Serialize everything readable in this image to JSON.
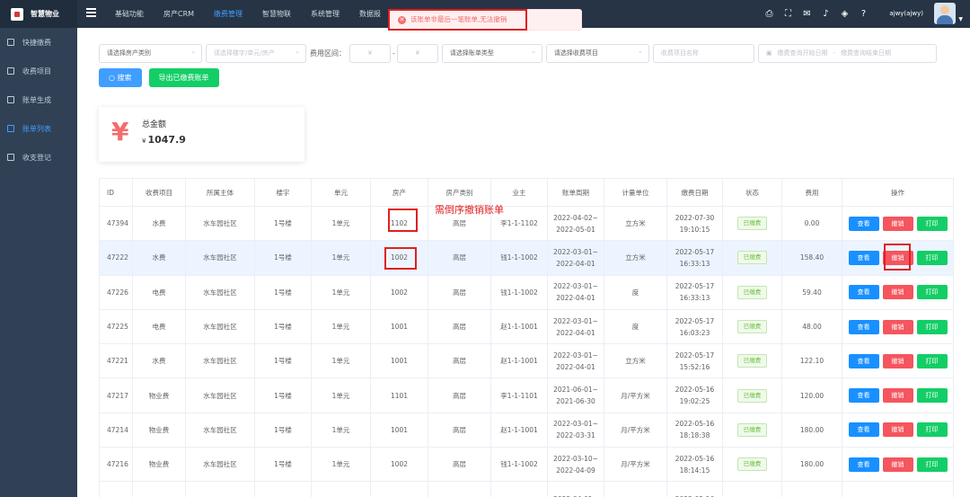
{
  "app": {
    "name": "智慧物业"
  },
  "nav": [
    "基础功能",
    "房产CRM",
    "缴费管理",
    "智慧物联",
    "系统管理",
    "数据报"
  ],
  "nav_active": 2,
  "user": {
    "name": "ajwy(ajwy)"
  },
  "sidebar": [
    "快捷缴费",
    "收费项目",
    "账单生成",
    "账单列表",
    "收支登记"
  ],
  "sidebar_active": 3,
  "filters": {
    "house_type": "请选择房产类别",
    "building_placeholder": "请选择楼宇/单元/房产",
    "fee_range_label": "费用区间：",
    "yen_min": "¥",
    "range_dash": "-",
    "yen_max": "¥",
    "bill_type": "请选择账单类型",
    "fee_item": "请选择收费项目",
    "item_name_placeholder": "收费项目名称",
    "start_date_placeholder": "缴费查询开始日期",
    "date_dash": "-",
    "end_date_placeholder": "缴费查询结束日期"
  },
  "buttons": {
    "search": "搜索",
    "export": "导出已缴费账单"
  },
  "summary": {
    "symbol": "¥",
    "label": "总金额",
    "currency": "¥",
    "amount": "1047.9"
  },
  "toast": {
    "text": "该账单非最后一笔账单,无法撤销"
  },
  "annotation": "需倒序撤销账单",
  "table": {
    "headers": [
      "ID",
      "收费项目",
      "所属主体",
      "楼宇",
      "单元",
      "房产",
      "房产类别",
      "业主",
      "账单周期",
      "计量单位",
      "缴费日期",
      "状态",
      "费用",
      "操作"
    ],
    "actions": {
      "view": "查看",
      "cancel": "撤销",
      "print": "打印"
    },
    "rows": [
      {
        "id": "47394",
        "item": "水费",
        "org": "水车园社区",
        "building": "1号楼",
        "unit": "1单元",
        "house": "1102",
        "type": "高层",
        "owner": "李1-1-1102",
        "p1": "2022-04-02~",
        "p2": "2022-05-01",
        "measure": "立方米",
        "d1": "2022-07-30",
        "d2": "19:10:15",
        "status": "已缴费",
        "fee": "0.00"
      },
      {
        "id": "47222",
        "item": "水费",
        "org": "水车园社区",
        "building": "1号楼",
        "unit": "1单元",
        "house": "1002",
        "type": "高层",
        "owner": "钱1-1-1002",
        "p1": "2022-03-01~",
        "p2": "2022-04-01",
        "measure": "立方米",
        "d1": "2022-05-17",
        "d2": "16:33:13",
        "status": "已缴费",
        "fee": "158.40"
      },
      {
        "id": "47226",
        "item": "电费",
        "org": "水车园社区",
        "building": "1号楼",
        "unit": "1单元",
        "house": "1002",
        "type": "高层",
        "owner": "钱1-1-1002",
        "p1": "2022-03-01~",
        "p2": "2022-04-01",
        "measure": "度",
        "d1": "2022-05-17",
        "d2": "16:33:13",
        "status": "已缴费",
        "fee": "59.40"
      },
      {
        "id": "47225",
        "item": "电费",
        "org": "水车园社区",
        "building": "1号楼",
        "unit": "1单元",
        "house": "1001",
        "type": "高层",
        "owner": "赵1-1-1001",
        "p1": "2022-03-01~",
        "p2": "2022-04-01",
        "measure": "度",
        "d1": "2022-05-17",
        "d2": "16:03:23",
        "status": "已缴费",
        "fee": "48.00"
      },
      {
        "id": "47221",
        "item": "水费",
        "org": "水车园社区",
        "building": "1号楼",
        "unit": "1单元",
        "house": "1001",
        "type": "高层",
        "owner": "赵1-1-1001",
        "p1": "2022-03-01~",
        "p2": "2022-04-01",
        "measure": "立方米",
        "d1": "2022-05-17",
        "d2": "15:52:16",
        "status": "已缴费",
        "fee": "122.10"
      },
      {
        "id": "47217",
        "item": "物业费",
        "org": "水车园社区",
        "building": "1号楼",
        "unit": "1单元",
        "house": "1101",
        "type": "高层",
        "owner": "李1-1-1101",
        "p1": "2021-06-01~",
        "p2": "2021-06-30",
        "measure": "月/平方米",
        "d1": "2022-05-16",
        "d2": "19:02:25",
        "status": "已缴费",
        "fee": "120.00"
      },
      {
        "id": "47214",
        "item": "物业费",
        "org": "水车园社区",
        "building": "1号楼",
        "unit": "1单元",
        "house": "1001",
        "type": "高层",
        "owner": "赵1-1-1001",
        "p1": "2022-03-01~",
        "p2": "2022-03-31",
        "measure": "月/平方米",
        "d1": "2022-05-16",
        "d2": "18:18:38",
        "status": "已缴费",
        "fee": "180.00"
      },
      {
        "id": "47216",
        "item": "物业费",
        "org": "水车园社区",
        "building": "1号楼",
        "unit": "1单元",
        "house": "1002",
        "type": "高层",
        "owner": "钱1-1-1002",
        "p1": "2022-03-10~",
        "p2": "2022-04-09",
        "measure": "月/平方米",
        "d1": "2022-05-16",
        "d2": "18:14:15",
        "status": "已缴费",
        "fee": "180.00"
      },
      {
        "id": "",
        "item": "",
        "org": "",
        "building": "",
        "unit": "",
        "house": "",
        "type": "",
        "owner": "",
        "p1": "2022-04-01~",
        "p2": "",
        "measure": "",
        "d1": "2022-05-16",
        "d2": "",
        "status": "",
        "fee": ""
      }
    ]
  },
  "colors": {
    "sidebar": "#304156",
    "topbar": "#263445",
    "primary": "#409eff",
    "success": "#13ce66",
    "danger": "#f5555e",
    "annotation": "#e02020"
  }
}
